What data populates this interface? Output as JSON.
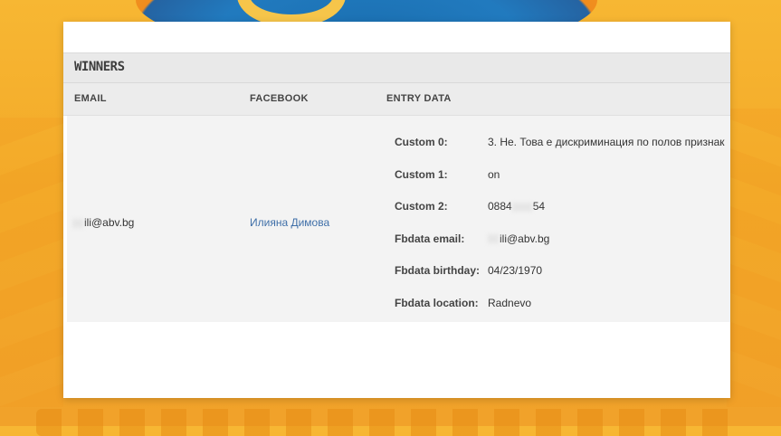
{
  "section": {
    "title": "WINNERS"
  },
  "columns": {
    "email": "EMAIL",
    "facebook": "FACEBOOK",
    "entry_data": "ENTRY DATA"
  },
  "winner": {
    "email": "ili@abv.bg",
    "facebook_name": "Илияна Димова",
    "entries": [
      {
        "label": "Custom 0:",
        "value": "3. Не. Това е дискриминация по полов признак"
      },
      {
        "label": "Custom 1:",
        "value": "on"
      },
      {
        "label": "Custom 2:",
        "value_prefix": "0884",
        "value_suffix": "54"
      },
      {
        "label": "Fbdata email:",
        "value": "ili@abv.bg"
      },
      {
        "label": "Fbdata birthday:",
        "value": "04/23/1970"
      },
      {
        "label": "Fbdata location:",
        "value": "Radnevo"
      }
    ]
  }
}
